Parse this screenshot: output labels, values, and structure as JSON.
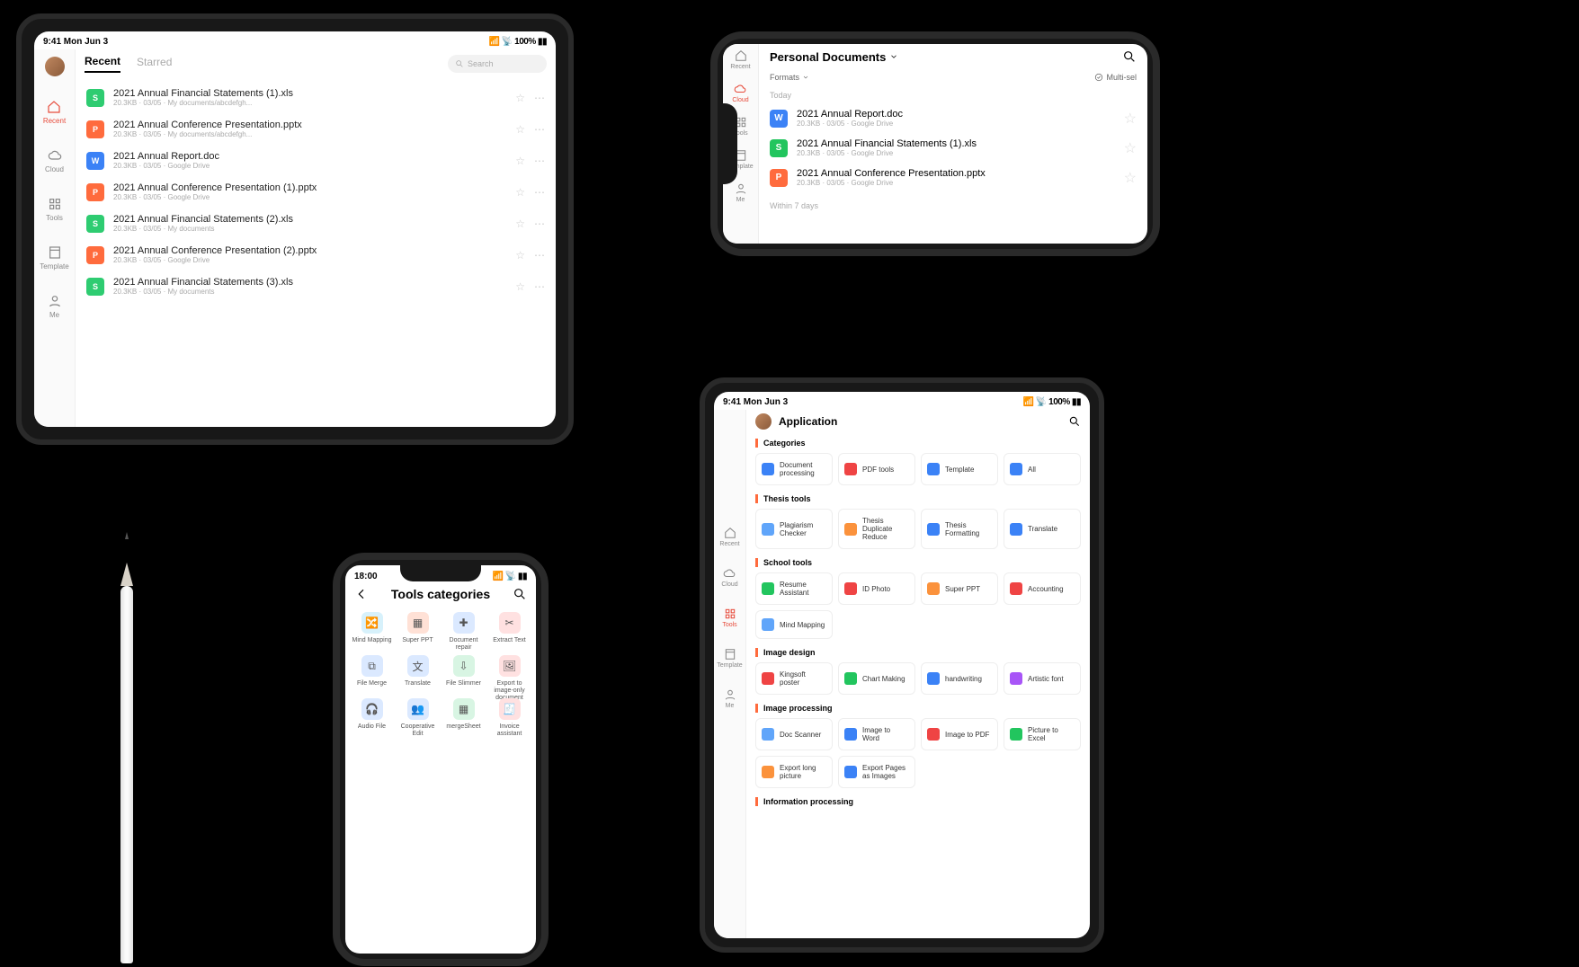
{
  "status": {
    "time_left": "9:41  Mon Jun 3",
    "right": "📶 📡 100% ▮▮",
    "time_phone": "18:00"
  },
  "dev1": {
    "tabs": {
      "recent": "Recent",
      "starred": "Starred"
    },
    "search_placeholder": "Search",
    "sidebar": [
      {
        "label": "Recent",
        "active": true
      },
      {
        "label": "Cloud"
      },
      {
        "label": "Tools"
      },
      {
        "label": "Template"
      },
      {
        "label": "Me"
      }
    ],
    "files": [
      {
        "type": "xls",
        "name": "2021 Annual Financial Statements (1).xls",
        "sub": "20.3KB · 03/05 · My documents/abcdefgh..."
      },
      {
        "type": "ppt",
        "name": "2021 Annual Conference Presentation.pptx",
        "sub": "20.3KB · 03/05 · My documents/abcdefgh..."
      },
      {
        "type": "doc",
        "name": "2021 Annual Report.doc",
        "sub": "20.3KB · 03/05 · Google Drive"
      },
      {
        "type": "ppt",
        "name": "2021 Annual Conference Presentation (1).pptx",
        "sub": "20.3KB · 03/05 · Google Drive"
      },
      {
        "type": "xls",
        "name": "2021 Annual Financial Statements (2).xls",
        "sub": "20.3KB · 03/05 · My documents"
      },
      {
        "type": "ppt",
        "name": "2021 Annual Conference Presentation (2).pptx",
        "sub": "20.3KB · 03/05 · Google Drive"
      },
      {
        "type": "xls",
        "name": "2021 Annual Financial Statements (3).xls",
        "sub": "20.3KB · 03/05 · My documents"
      }
    ]
  },
  "dev2": {
    "title": "Personal Documents",
    "formats": "Formats",
    "multisel": "Multi-sel",
    "section1": "Today",
    "section2": "Within 7 days",
    "sidebar": [
      {
        "label": "Recent"
      },
      {
        "label": "Cloud",
        "active": true
      },
      {
        "label": "Tools"
      },
      {
        "label": "Template"
      },
      {
        "label": "Me"
      }
    ],
    "files": [
      {
        "type": "doc",
        "name": "2021 Annual Report.doc",
        "sub": "20.3KB · 03/05 · Google Drive"
      },
      {
        "type": "xls",
        "name": "2021 Annual Financial Statements (1).xls",
        "sub": "20.3KB · 03/05 · Google Drive"
      },
      {
        "type": "ppt",
        "name": "2021 Annual Conference Presentation.pptx",
        "sub": "20.3KB · 03/05 · Google Drive"
      }
    ]
  },
  "dev3": {
    "title": "Tools categories",
    "tools": [
      {
        "label": "Mind Mapping",
        "color": "#d7f1fb",
        "g": "🔀"
      },
      {
        "label": "Super PPT",
        "color": "#ffe1d6",
        "g": "▦"
      },
      {
        "label": "Document repair",
        "color": "#dbe9ff",
        "g": "✚"
      },
      {
        "label": "Extract Text",
        "color": "#ffe1e1",
        "g": "✂"
      },
      {
        "label": "File Merge",
        "color": "#dbe9ff",
        "g": "⧉"
      },
      {
        "label": "Translate",
        "color": "#dbe9ff",
        "g": "文"
      },
      {
        "label": "File Slimmer",
        "color": "#d8f5e3",
        "g": "⇩"
      },
      {
        "label": "Export to image-only document",
        "color": "#ffe1e1",
        "g": "🖼"
      },
      {
        "label": "Audio File",
        "color": "#dbe9ff",
        "g": "🎧"
      },
      {
        "label": "Cooperative Edit",
        "color": "#dbe9ff",
        "g": "👥"
      },
      {
        "label": "mergeSheet",
        "color": "#d8f5e3",
        "g": "▦"
      },
      {
        "label": "Invoice assistant",
        "color": "#ffe1e1",
        "g": "🧾"
      }
    ]
  },
  "dev4": {
    "title": "Application",
    "sidebar": [
      {
        "label": "Recent"
      },
      {
        "label": "Cloud"
      },
      {
        "label": "Tools",
        "active": true
      },
      {
        "label": "Template"
      },
      {
        "label": "Me"
      }
    ],
    "sections": [
      {
        "title": "Categories",
        "cards": [
          {
            "label": "Document processing",
            "c": "#3b82f6"
          },
          {
            "label": "PDF tools",
            "c": "#ef4444"
          },
          {
            "label": "Template",
            "c": "#3b82f6"
          },
          {
            "label": "All",
            "c": "#3b82f6"
          }
        ]
      },
      {
        "title": "Thesis tools",
        "cards": [
          {
            "label": "Plagiarism Checker",
            "c": "#60a5fa"
          },
          {
            "label": "Thesis Duplicate Reduce",
            "c": "#fb923c"
          },
          {
            "label": "Thesis Formatting",
            "c": "#3b82f6"
          },
          {
            "label": "Translate",
            "c": "#3b82f6"
          }
        ]
      },
      {
        "title": "School tools",
        "cards": [
          {
            "label": "Resume Assistant",
            "c": "#22c55e"
          },
          {
            "label": "ID Photo",
            "c": "#ef4444"
          },
          {
            "label": "Super PPT",
            "c": "#fb923c"
          },
          {
            "label": "Accounting",
            "c": "#ef4444"
          },
          {
            "label": "Mind Mapping",
            "c": "#60a5fa"
          }
        ]
      },
      {
        "title": "Image design",
        "cards": [
          {
            "label": "Kingsoft poster",
            "c": "#ef4444"
          },
          {
            "label": "Chart Making",
            "c": "#22c55e"
          },
          {
            "label": "handwriting",
            "c": "#3b82f6"
          },
          {
            "label": "Artistic font",
            "c": "#a855f7"
          }
        ]
      },
      {
        "title": "Image processing",
        "cards": [
          {
            "label": "Doc Scanner",
            "c": "#60a5fa"
          },
          {
            "label": "Image to Word",
            "c": "#3b82f6"
          },
          {
            "label": "Image to PDF",
            "c": "#ef4444"
          },
          {
            "label": "Picture to Excel",
            "c": "#22c55e"
          },
          {
            "label": "Export long picture",
            "c": "#fb923c"
          },
          {
            "label": "Export Pages as Images",
            "c": "#3b82f6"
          }
        ]
      },
      {
        "title": "Information processing",
        "cards": []
      }
    ]
  }
}
